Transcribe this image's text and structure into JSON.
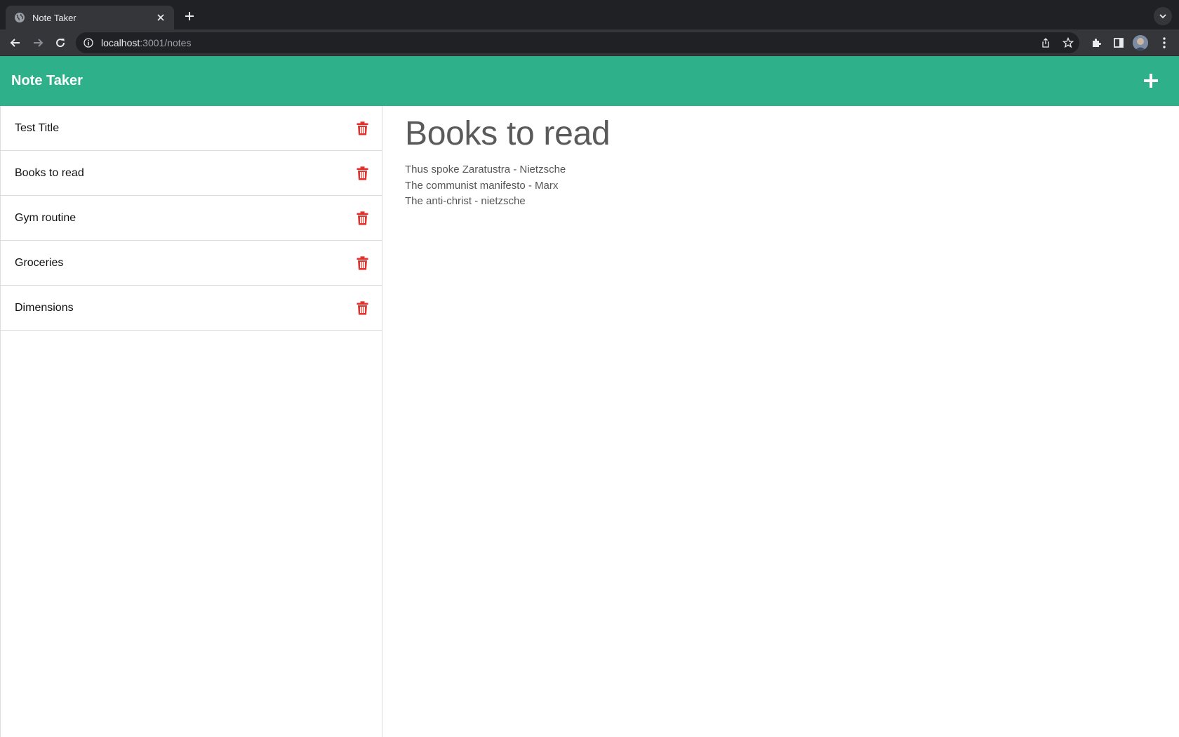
{
  "browser": {
    "tab_title": "Note Taker",
    "url_host": "localhost",
    "url_path": ":3001/notes"
  },
  "app": {
    "brand": "Note Taker",
    "colors": {
      "navbar": "#2eb18a",
      "delete_icon": "#e0332d"
    }
  },
  "notes": [
    {
      "title": "Test Title"
    },
    {
      "title": "Books to read"
    },
    {
      "title": "Gym routine"
    },
    {
      "title": "Groceries"
    },
    {
      "title": "Dimensions"
    }
  ],
  "active_note": {
    "title": "Books to read",
    "lines": [
      "Thus spoke Zaratustra - Nietzsche",
      "The communist manifesto - Marx",
      "The anti-christ - nietzsche"
    ]
  }
}
